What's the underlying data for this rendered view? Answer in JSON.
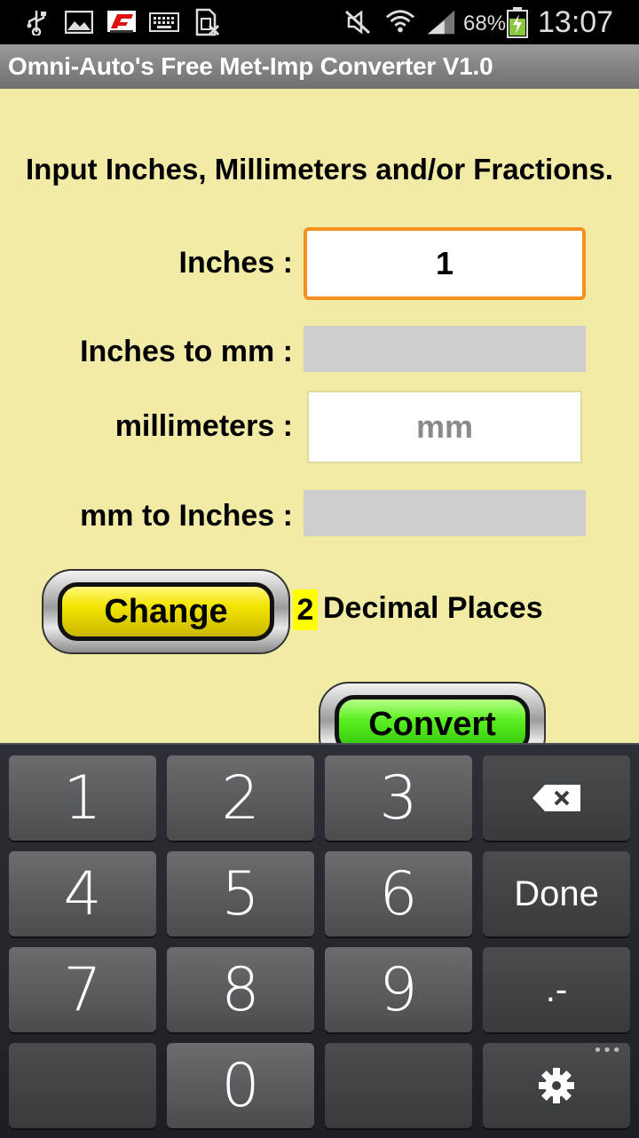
{
  "status_bar": {
    "battery": "68%",
    "time": "13:07",
    "icons": [
      "usb-icon",
      "image-icon",
      "f1-icon",
      "keyboard-icon",
      "sim-icon",
      "mute-icon",
      "wifi-icon",
      "signal-icon",
      "battery-icon"
    ]
  },
  "app": {
    "title": "Omni-Auto's Free Met-Imp Converter V1.0"
  },
  "form": {
    "heading": "Input  Inches, Millimeters and/or Fractions.",
    "inches_label": "Inches :",
    "inches_value": "1",
    "inches_to_mm_label": "Inches to mm :",
    "inches_to_mm_value": "",
    "mm_label": "millimeters :",
    "mm_placeholder": "mm",
    "mm_to_inches_label": "mm to Inches :",
    "mm_to_inches_value": "",
    "change_button": "Change",
    "decimal_places_value": "2",
    "decimal_places_label": "Decimal Places",
    "convert_button": "Convert"
  },
  "colors": {
    "background": "#f1eba6",
    "input_focus_border": "#f39020",
    "change_button": "#f2e400",
    "convert_button": "#5cf024",
    "decimal_highlight": "#ffff00"
  },
  "keyboard": {
    "keys": [
      "1",
      "2",
      "3",
      "",
      "4",
      "5",
      "6",
      "Done",
      "7",
      "8",
      "9",
      ".-",
      "",
      "0",
      "",
      ""
    ],
    "backspace_icon": "backspace-icon",
    "settings_icon": "gear-icon"
  }
}
